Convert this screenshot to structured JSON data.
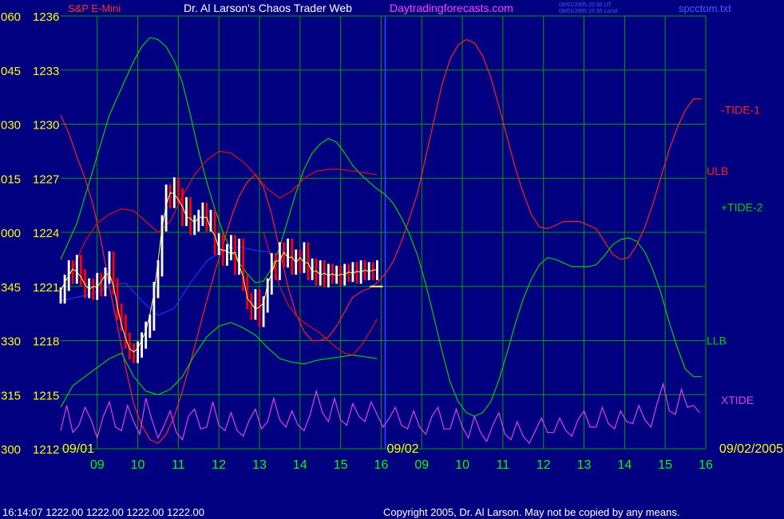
{
  "header": {
    "instrument": "S&P E-Mini",
    "title": "Dr. Al Larson's Chaos Trader Web",
    "website": "Daytradingforecasts.com",
    "timestamp_ut": "09/01/2005 20:30 UT",
    "timestamp_local": "09/01/2005 15:30 Local",
    "data_file": "spcctom.txt"
  },
  "footer": {
    "quote_line": "16:14:07  1222.00 1222.00 1222.00 1222.00",
    "copyright": "Copyright 2005, Dr. Al Larson. May not be copied by any means."
  },
  "colors": {
    "background": "#000080",
    "grid": "#00a000",
    "price_up": "#ffffff",
    "price_down": "#ff0000",
    "tide1": "#ff2020",
    "tide2": "#00d000",
    "xtide": "#e040e0",
    "bands": "#dd1010",
    "axis_label_left": "#ffff00",
    "axis_label_bottom": "#00ff00",
    "date_label": "#ffff00",
    "moving_avg": "#2030ff"
  },
  "chart_data": {
    "type": "line",
    "y_ticks": [
      {
        "angle": "060",
        "price": "1236"
      },
      {
        "angle": "045",
        "price": "1233"
      },
      {
        "angle": "030",
        "price": "1230"
      },
      {
        "angle": "015",
        "price": "1227"
      },
      {
        "angle": "000",
        "price": "1224"
      },
      {
        "angle": "345",
        "price": "1221"
      },
      {
        "angle": "330",
        "price": "1218"
      },
      {
        "angle": "315",
        "price": "1215"
      },
      {
        "angle": "300",
        "price": "1212"
      }
    ],
    "ylim": [
      1212,
      1236
    ],
    "x_tick_labels": [
      "09",
      "10",
      "11",
      "12",
      "13",
      "14",
      "15",
      "16",
      "09",
      "10",
      "11",
      "12",
      "13",
      "14",
      "15",
      "16"
    ],
    "x_tick_hours": [
      9.5,
      10.5,
      11.5,
      12.5,
      13.5,
      14.5,
      15.5,
      16.5,
      17.5,
      18.5,
      19.5,
      20.5,
      21.5,
      22.5,
      23.5,
      24.5
    ],
    "xlim": [
      8.6,
      24.5
    ],
    "date_labels": [
      {
        "text": "09/01",
        "hour": 8.6
      },
      {
        "text": "09/02",
        "hour": 16.6
      },
      {
        "text": "09/02/2005",
        "hour": 24.5
      }
    ],
    "day_divider_hour": 16.6,
    "grid": true,
    "series": [
      {
        "name": "-TIDE-1",
        "key": "tide1",
        "x": [
          8.6,
          8.8,
          9.0,
          9.2,
          9.4,
          9.6,
          9.8,
          10.0,
          10.2,
          10.4,
          10.6,
          10.8,
          11.0,
          11.2,
          11.4,
          11.6,
          11.8,
          12.0,
          12.2,
          12.4,
          12.6,
          12.8,
          13.0,
          13.2,
          13.4,
          13.6,
          13.8,
          14.0,
          14.2,
          14.4,
          14.6,
          14.8,
          15.0,
          15.2,
          15.4,
          15.6,
          15.8,
          16.0,
          16.2,
          16.4,
          16.6,
          16.8,
          17.0,
          17.2,
          17.4,
          17.6,
          17.8,
          18.0,
          18.2,
          18.4,
          18.6,
          18.8,
          19.0,
          19.2,
          19.4,
          19.6,
          19.8,
          20.0,
          20.2,
          20.4,
          20.6,
          20.8,
          21.0,
          21.2,
          21.4,
          21.6,
          21.8,
          22.0,
          22.2,
          22.4,
          22.6,
          22.8,
          23.0,
          23.2,
          23.4,
          23.6,
          23.8,
          24.0,
          24.2,
          24.4
        ],
        "values": [
          1230.5,
          1229.5,
          1228.2,
          1227.0,
          1225.5,
          1223.5,
          1221.0,
          1218.8,
          1216.5,
          1214.5,
          1213.3,
          1212.5,
          1212.3,
          1212.8,
          1213.8,
          1215.2,
          1216.8,
          1218.5,
          1220.2,
          1221.8,
          1223.3,
          1224.8,
          1226.0,
          1226.8,
          1227.2,
          1226.5,
          1225.0,
          1223.0,
          1221.0,
          1219.5,
          1218.5,
          1218.0,
          1218.0,
          1218.2,
          1218.8,
          1219.6,
          1220.4,
          1220.7,
          1220.9,
          1221.2,
          1221.7,
          1222.4,
          1223.5,
          1224.8,
          1226.2,
          1228.2,
          1230.2,
          1232.2,
          1233.6,
          1234.4,
          1234.7,
          1234.5,
          1233.8,
          1232.6,
          1231.0,
          1229.3,
          1227.6,
          1226.2,
          1225.0,
          1224.3,
          1224.2,
          1224.4,
          1224.6,
          1224.6,
          1224.6,
          1224.4,
          1224.2,
          1223.5,
          1222.8,
          1222.5,
          1222.6,
          1223.3,
          1224.3,
          1225.6,
          1227.1,
          1228.6,
          1229.8,
          1230.8,
          1231.4,
          1231.4
        ]
      },
      {
        "name": "+TIDE-2",
        "key": "tide2",
        "x": [
          8.6,
          8.8,
          9.0,
          9.2,
          9.4,
          9.6,
          9.8,
          10.0,
          10.2,
          10.4,
          10.6,
          10.8,
          11.0,
          11.2,
          11.4,
          11.6,
          11.8,
          12.0,
          12.2,
          12.4,
          12.6,
          12.8,
          13.0,
          13.2,
          13.4,
          13.6,
          13.8,
          14.0,
          14.2,
          14.4,
          14.6,
          14.8,
          15.0,
          15.2,
          15.4,
          15.6,
          15.8,
          16.0,
          16.2,
          16.4,
          16.6,
          16.8,
          17.0,
          17.2,
          17.4,
          17.6,
          17.8,
          18.0,
          18.2,
          18.4,
          18.6,
          18.8,
          19.0,
          19.2,
          19.4,
          19.6,
          19.8,
          20.0,
          20.2,
          20.4,
          20.6,
          20.8,
          21.0,
          21.2,
          21.4,
          21.6,
          21.8,
          22.0,
          22.2,
          22.4,
          22.6,
          22.8,
          23.0,
          23.2,
          23.4,
          23.6,
          23.8,
          24.0,
          24.2,
          24.4
        ],
        "values": [
          1222.5,
          1223.5,
          1224.5,
          1226.0,
          1227.5,
          1229.0,
          1230.5,
          1231.5,
          1232.5,
          1233.5,
          1234.3,
          1234.8,
          1234.7,
          1234.3,
          1233.5,
          1232.3,
          1230.5,
          1228.5,
          1226.8,
          1225.3,
          1224.0,
          1223.0,
          1222.3,
          1221.7,
          1221.2,
          1221.3,
          1222.0,
          1223.2,
          1224.7,
          1226.2,
          1227.5,
          1228.4,
          1228.9,
          1229.2,
          1229.0,
          1228.4,
          1227.7,
          1227.2,
          1226.8,
          1226.4,
          1226.1,
          1225.6,
          1224.8,
          1223.9,
          1222.7,
          1221.1,
          1219.3,
          1217.4,
          1215.7,
          1214.6,
          1214.0,
          1213.8,
          1214.0,
          1214.6,
          1215.8,
          1217.3,
          1218.9,
          1220.3,
          1221.4,
          1222.2,
          1222.6,
          1222.5,
          1222.3,
          1222.1,
          1222.1,
          1222.1,
          1222.2,
          1222.7,
          1223.3,
          1223.6,
          1223.7,
          1223.5,
          1222.9,
          1221.9,
          1220.6,
          1219.0,
          1217.6,
          1216.4,
          1216.0,
          1216.0
        ]
      },
      {
        "name": "XTIDE",
        "key": "xtide",
        "x": [
          8.6,
          8.75,
          8.9,
          9.05,
          9.2,
          9.35,
          9.5,
          9.65,
          9.8,
          9.95,
          10.1,
          10.25,
          10.4,
          10.55,
          10.7,
          10.85,
          11.0,
          11.15,
          11.3,
          11.45,
          11.6,
          11.75,
          11.9,
          12.05,
          12.2,
          12.35,
          12.5,
          12.65,
          12.8,
          12.95,
          13.1,
          13.25,
          13.4,
          13.55,
          13.7,
          13.85,
          14.0,
          14.15,
          14.3,
          14.45,
          14.6,
          14.75,
          14.9,
          15.05,
          15.2,
          15.35,
          15.5,
          15.65,
          15.8,
          15.95,
          16.1,
          16.25,
          16.4,
          16.55,
          16.7,
          16.85,
          17.0,
          17.15,
          17.3,
          17.45,
          17.6,
          17.75,
          17.9,
          18.05,
          18.2,
          18.35,
          18.5,
          18.65,
          18.8,
          18.95,
          19.1,
          19.25,
          19.4,
          19.55,
          19.7,
          19.85,
          20.0,
          20.15,
          20.3,
          20.45,
          20.6,
          20.75,
          20.9,
          21.05,
          21.2,
          21.35,
          21.5,
          21.65,
          21.8,
          21.95,
          22.1,
          22.25,
          22.4,
          22.55,
          22.7,
          22.85,
          23.0,
          23.15,
          23.3,
          23.45,
          23.6,
          23.75,
          23.9,
          24.05,
          24.2,
          24.35
        ],
        "values": [
          1213.0,
          1214.4,
          1212.9,
          1213.3,
          1214.3,
          1213.6,
          1212.6,
          1213.8,
          1214.6,
          1213.2,
          1213.0,
          1214.4,
          1213.5,
          1212.8,
          1214.8,
          1213.6,
          1212.6,
          1213.3,
          1214.1,
          1212.9,
          1212.5,
          1213.8,
          1214.2,
          1213.1,
          1213.2,
          1214.6,
          1213.3,
          1213.0,
          1214.0,
          1213.0,
          1212.7,
          1213.6,
          1214.2,
          1213.1,
          1213.5,
          1214.8,
          1213.6,
          1213.2,
          1214.1,
          1213.3,
          1213.0,
          1213.9,
          1215.2,
          1214.0,
          1213.5,
          1214.8,
          1213.6,
          1213.3,
          1214.5,
          1213.8,
          1213.5,
          1214.6,
          1213.9,
          1213.2,
          1213.7,
          1214.3,
          1213.3,
          1213.1,
          1214.1,
          1213.2,
          1212.8,
          1213.8,
          1214.3,
          1213.1,
          1213.1,
          1214.2,
          1213.2,
          1212.6,
          1213.8,
          1212.9,
          1212.4,
          1213.3,
          1214.0,
          1212.8,
          1212.5,
          1213.5,
          1212.7,
          1212.3,
          1213.0,
          1213.7,
          1212.9,
          1212.9,
          1213.7,
          1213.0,
          1212.7,
          1213.6,
          1214.1,
          1213.2,
          1213.2,
          1214.3,
          1213.4,
          1213.1,
          1214.1,
          1213.5,
          1213.4,
          1214.4,
          1213.6,
          1213.2,
          1214.5,
          1215.6,
          1214.1,
          1213.9,
          1215.3,
          1214.3,
          1214.4,
          1214.0
        ]
      },
      {
        "name": "ULB",
        "key": "bands",
        "x": [
          8.6,
          8.9,
          9.2,
          9.5,
          9.8,
          10.1,
          10.4,
          10.7,
          11.0,
          11.3,
          11.6,
          11.9,
          12.2,
          12.5,
          12.8,
          13.1,
          13.4,
          13.7,
          14.0,
          14.3,
          14.6,
          14.9,
          15.2,
          15.5,
          15.8,
          16.1,
          16.4
        ],
        "values": [
          1220.8,
          1222.0,
          1223.5,
          1224.5,
          1225.0,
          1225.3,
          1225.2,
          1224.6,
          1224.0,
          1224.6,
          1226.0,
          1227.2,
          1228.0,
          1228.5,
          1228.4,
          1227.9,
          1227.2,
          1226.4,
          1225.9,
          1226.3,
          1227.0,
          1227.4,
          1227.5,
          1227.5,
          1227.4,
          1227.3,
          1227.2
        ]
      },
      {
        "name": "LLB",
        "key": "tide2",
        "x": [
          8.6,
          8.9,
          9.2,
          9.5,
          9.8,
          10.1,
          10.4,
          10.7,
          11.0,
          11.3,
          11.6,
          11.9,
          12.2,
          12.5,
          12.8,
          13.1,
          13.4,
          13.7,
          14.0,
          14.3,
          14.6,
          14.9,
          15.2,
          15.5,
          15.8,
          16.1,
          16.4
        ],
        "values": [
          1214.3,
          1215.5,
          1216.0,
          1216.5,
          1217.0,
          1217.3,
          1216.0,
          1215.2,
          1215.0,
          1215.3,
          1216.0,
          1217.2,
          1218.2,
          1218.8,
          1219.0,
          1218.7,
          1218.3,
          1217.6,
          1217.0,
          1216.8,
          1216.7,
          1216.9,
          1217.0,
          1217.1,
          1217.2,
          1217.1,
          1217.0
        ]
      },
      {
        "name": "",
        "key": "bands",
        "x": [
          13.6,
          13.8,
          14.0,
          14.2,
          14.4,
          14.6,
          14.8,
          15.0,
          15.2,
          15.4,
          15.6,
          15.8,
          16.0,
          16.2,
          16.4
        ],
        "values": [
          1224.0,
          1222.5,
          1221.0,
          1220.0,
          1219.4,
          1219.0,
          1218.7,
          1218.4,
          1218.0,
          1217.6,
          1217.3,
          1217.2,
          1217.7,
          1218.4,
          1219.2
        ]
      },
      {
        "name": "",
        "key": "moving_avg",
        "x": [
          8.6,
          9.0,
          9.4,
          9.8,
          10.2,
          10.6,
          11.0,
          11.4,
          11.8,
          12.2,
          12.6,
          13.0,
          13.4,
          13.8
        ],
        "values": [
          1220.2,
          1220.4,
          1220.6,
          1221.0,
          1221.2,
          1220.2,
          1219.4,
          1219.8,
          1221.2,
          1222.4,
          1223.0,
          1223.2,
          1223.0,
          1222.9
        ]
      }
    ],
    "price_bars": {
      "x": [
        8.6,
        8.7,
        8.8,
        8.9,
        9.0,
        9.1,
        9.2,
        9.3,
        9.4,
        9.5,
        9.6,
        9.7,
        9.8,
        9.9,
        10.0,
        10.1,
        10.2,
        10.3,
        10.4,
        10.5,
        10.6,
        10.7,
        10.8,
        10.9,
        11.0,
        11.1,
        11.2,
        11.3,
        11.4,
        11.5,
        11.6,
        11.7,
        11.8,
        11.9,
        12.0,
        12.1,
        12.2,
        12.3,
        12.4,
        12.5,
        12.6,
        12.7,
        12.8,
        12.9,
        13.0,
        13.1,
        13.2,
        13.3,
        13.4,
        13.5,
        13.6,
        13.7,
        13.8,
        13.9,
        14.0,
        14.1,
        14.2,
        14.3,
        14.4,
        14.5,
        14.6,
        14.7,
        14.8,
        14.9,
        15.0,
        15.1,
        15.2,
        15.3,
        15.4,
        15.5,
        15.6,
        15.7,
        15.8,
        15.9,
        16.0,
        16.1,
        16.2,
        16.3,
        16.4
      ],
      "close": [
        1220.5,
        1221.2,
        1222.0,
        1221.6,
        1222.3,
        1221.5,
        1220.8,
        1221.0,
        1220.7,
        1221.3,
        1220.9,
        1221.6,
        1222.5,
        1221.0,
        1219.6,
        1219.0,
        1218.0,
        1217.4,
        1217.2,
        1217.5,
        1218.0,
        1218.6,
        1219.0,
        1220.8,
        1222.0,
        1224.5,
        1226.2,
        1225.8,
        1226.6,
        1226.0,
        1224.8,
        1225.5,
        1224.3,
        1224.5,
        1224.8,
        1225.2,
        1224.5,
        1224.8,
        1223.2,
        1223.5,
        1222.6,
        1222.9,
        1223.4,
        1222.1,
        1223.2,
        1221.2,
        1220.2,
        1219.6,
        1220.4,
        1219.2,
        1220.0,
        1221.0,
        1222.4,
        1221.8,
        1223.0,
        1222.5,
        1223.2,
        1222.1,
        1222.6,
        1222.2,
        1223.0,
        1221.8,
        1222.1,
        1221.5,
        1222.0,
        1221.4,
        1221.8,
        1221.6,
        1221.7,
        1221.5,
        1221.8,
        1221.7,
        1221.9,
        1221.6,
        1222.0,
        1221.8,
        1221.9,
        1221.8,
        1222.0
      ],
      "spread": 0.9
    },
    "last_price_marker": {
      "hour": 16.5,
      "price": 1221.0
    },
    "series_labels": [
      {
        "text": "-TIDE-1",
        "key": "tide1",
        "price": 1230.8
      },
      {
        "text": "ULB",
        "key": "tide1",
        "price": 1227.4
      },
      {
        "text": "+TIDE-2",
        "key": "tide2",
        "price": 1225.4
      },
      {
        "text": "LLB",
        "key": "tide2",
        "price": 1218.0
      },
      {
        "text": "XTIDE",
        "key": "xtide",
        "price": 1214.7
      }
    ]
  }
}
